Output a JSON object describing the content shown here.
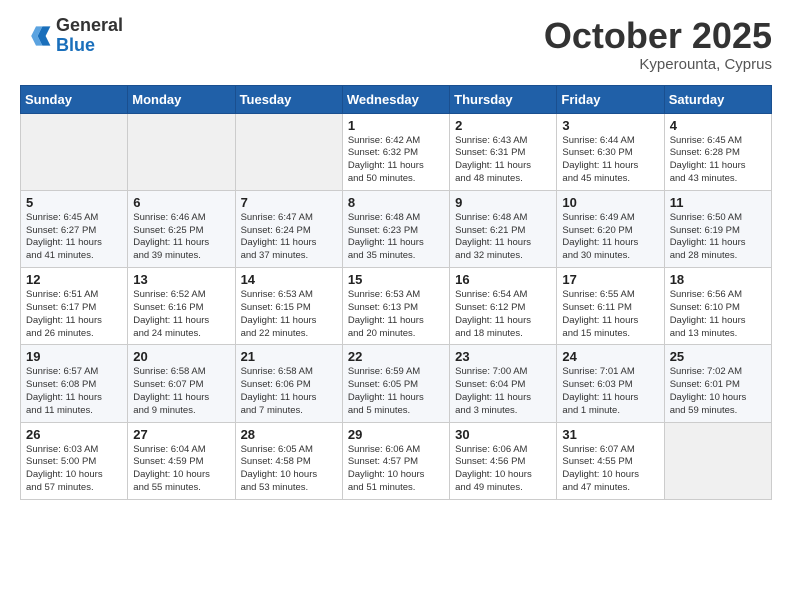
{
  "header": {
    "logo_general": "General",
    "logo_blue": "Blue",
    "month": "October 2025",
    "location": "Kyperounta, Cyprus"
  },
  "weekdays": [
    "Sunday",
    "Monday",
    "Tuesday",
    "Wednesday",
    "Thursday",
    "Friday",
    "Saturday"
  ],
  "weeks": [
    [
      {
        "day": "",
        "info": ""
      },
      {
        "day": "",
        "info": ""
      },
      {
        "day": "",
        "info": ""
      },
      {
        "day": "1",
        "info": "Sunrise: 6:42 AM\nSunset: 6:32 PM\nDaylight: 11 hours\nand 50 minutes."
      },
      {
        "day": "2",
        "info": "Sunrise: 6:43 AM\nSunset: 6:31 PM\nDaylight: 11 hours\nand 48 minutes."
      },
      {
        "day": "3",
        "info": "Sunrise: 6:44 AM\nSunset: 6:30 PM\nDaylight: 11 hours\nand 45 minutes."
      },
      {
        "day": "4",
        "info": "Sunrise: 6:45 AM\nSunset: 6:28 PM\nDaylight: 11 hours\nand 43 minutes."
      }
    ],
    [
      {
        "day": "5",
        "info": "Sunrise: 6:45 AM\nSunset: 6:27 PM\nDaylight: 11 hours\nand 41 minutes."
      },
      {
        "day": "6",
        "info": "Sunrise: 6:46 AM\nSunset: 6:25 PM\nDaylight: 11 hours\nand 39 minutes."
      },
      {
        "day": "7",
        "info": "Sunrise: 6:47 AM\nSunset: 6:24 PM\nDaylight: 11 hours\nand 37 minutes."
      },
      {
        "day": "8",
        "info": "Sunrise: 6:48 AM\nSunset: 6:23 PM\nDaylight: 11 hours\nand 35 minutes."
      },
      {
        "day": "9",
        "info": "Sunrise: 6:48 AM\nSunset: 6:21 PM\nDaylight: 11 hours\nand 32 minutes."
      },
      {
        "day": "10",
        "info": "Sunrise: 6:49 AM\nSunset: 6:20 PM\nDaylight: 11 hours\nand 30 minutes."
      },
      {
        "day": "11",
        "info": "Sunrise: 6:50 AM\nSunset: 6:19 PM\nDaylight: 11 hours\nand 28 minutes."
      }
    ],
    [
      {
        "day": "12",
        "info": "Sunrise: 6:51 AM\nSunset: 6:17 PM\nDaylight: 11 hours\nand 26 minutes."
      },
      {
        "day": "13",
        "info": "Sunrise: 6:52 AM\nSunset: 6:16 PM\nDaylight: 11 hours\nand 24 minutes."
      },
      {
        "day": "14",
        "info": "Sunrise: 6:53 AM\nSunset: 6:15 PM\nDaylight: 11 hours\nand 22 minutes."
      },
      {
        "day": "15",
        "info": "Sunrise: 6:53 AM\nSunset: 6:13 PM\nDaylight: 11 hours\nand 20 minutes."
      },
      {
        "day": "16",
        "info": "Sunrise: 6:54 AM\nSunset: 6:12 PM\nDaylight: 11 hours\nand 18 minutes."
      },
      {
        "day": "17",
        "info": "Sunrise: 6:55 AM\nSunset: 6:11 PM\nDaylight: 11 hours\nand 15 minutes."
      },
      {
        "day": "18",
        "info": "Sunrise: 6:56 AM\nSunset: 6:10 PM\nDaylight: 11 hours\nand 13 minutes."
      }
    ],
    [
      {
        "day": "19",
        "info": "Sunrise: 6:57 AM\nSunset: 6:08 PM\nDaylight: 11 hours\nand 11 minutes."
      },
      {
        "day": "20",
        "info": "Sunrise: 6:58 AM\nSunset: 6:07 PM\nDaylight: 11 hours\nand 9 minutes."
      },
      {
        "day": "21",
        "info": "Sunrise: 6:58 AM\nSunset: 6:06 PM\nDaylight: 11 hours\nand 7 minutes."
      },
      {
        "day": "22",
        "info": "Sunrise: 6:59 AM\nSunset: 6:05 PM\nDaylight: 11 hours\nand 5 minutes."
      },
      {
        "day": "23",
        "info": "Sunrise: 7:00 AM\nSunset: 6:04 PM\nDaylight: 11 hours\nand 3 minutes."
      },
      {
        "day": "24",
        "info": "Sunrise: 7:01 AM\nSunset: 6:03 PM\nDaylight: 11 hours\nand 1 minute."
      },
      {
        "day": "25",
        "info": "Sunrise: 7:02 AM\nSunset: 6:01 PM\nDaylight: 10 hours\nand 59 minutes."
      }
    ],
    [
      {
        "day": "26",
        "info": "Sunrise: 6:03 AM\nSunset: 5:00 PM\nDaylight: 10 hours\nand 57 minutes."
      },
      {
        "day": "27",
        "info": "Sunrise: 6:04 AM\nSunset: 4:59 PM\nDaylight: 10 hours\nand 55 minutes."
      },
      {
        "day": "28",
        "info": "Sunrise: 6:05 AM\nSunset: 4:58 PM\nDaylight: 10 hours\nand 53 minutes."
      },
      {
        "day": "29",
        "info": "Sunrise: 6:06 AM\nSunset: 4:57 PM\nDaylight: 10 hours\nand 51 minutes."
      },
      {
        "day": "30",
        "info": "Sunrise: 6:06 AM\nSunset: 4:56 PM\nDaylight: 10 hours\nand 49 minutes."
      },
      {
        "day": "31",
        "info": "Sunrise: 6:07 AM\nSunset: 4:55 PM\nDaylight: 10 hours\nand 47 minutes."
      },
      {
        "day": "",
        "info": ""
      }
    ]
  ]
}
